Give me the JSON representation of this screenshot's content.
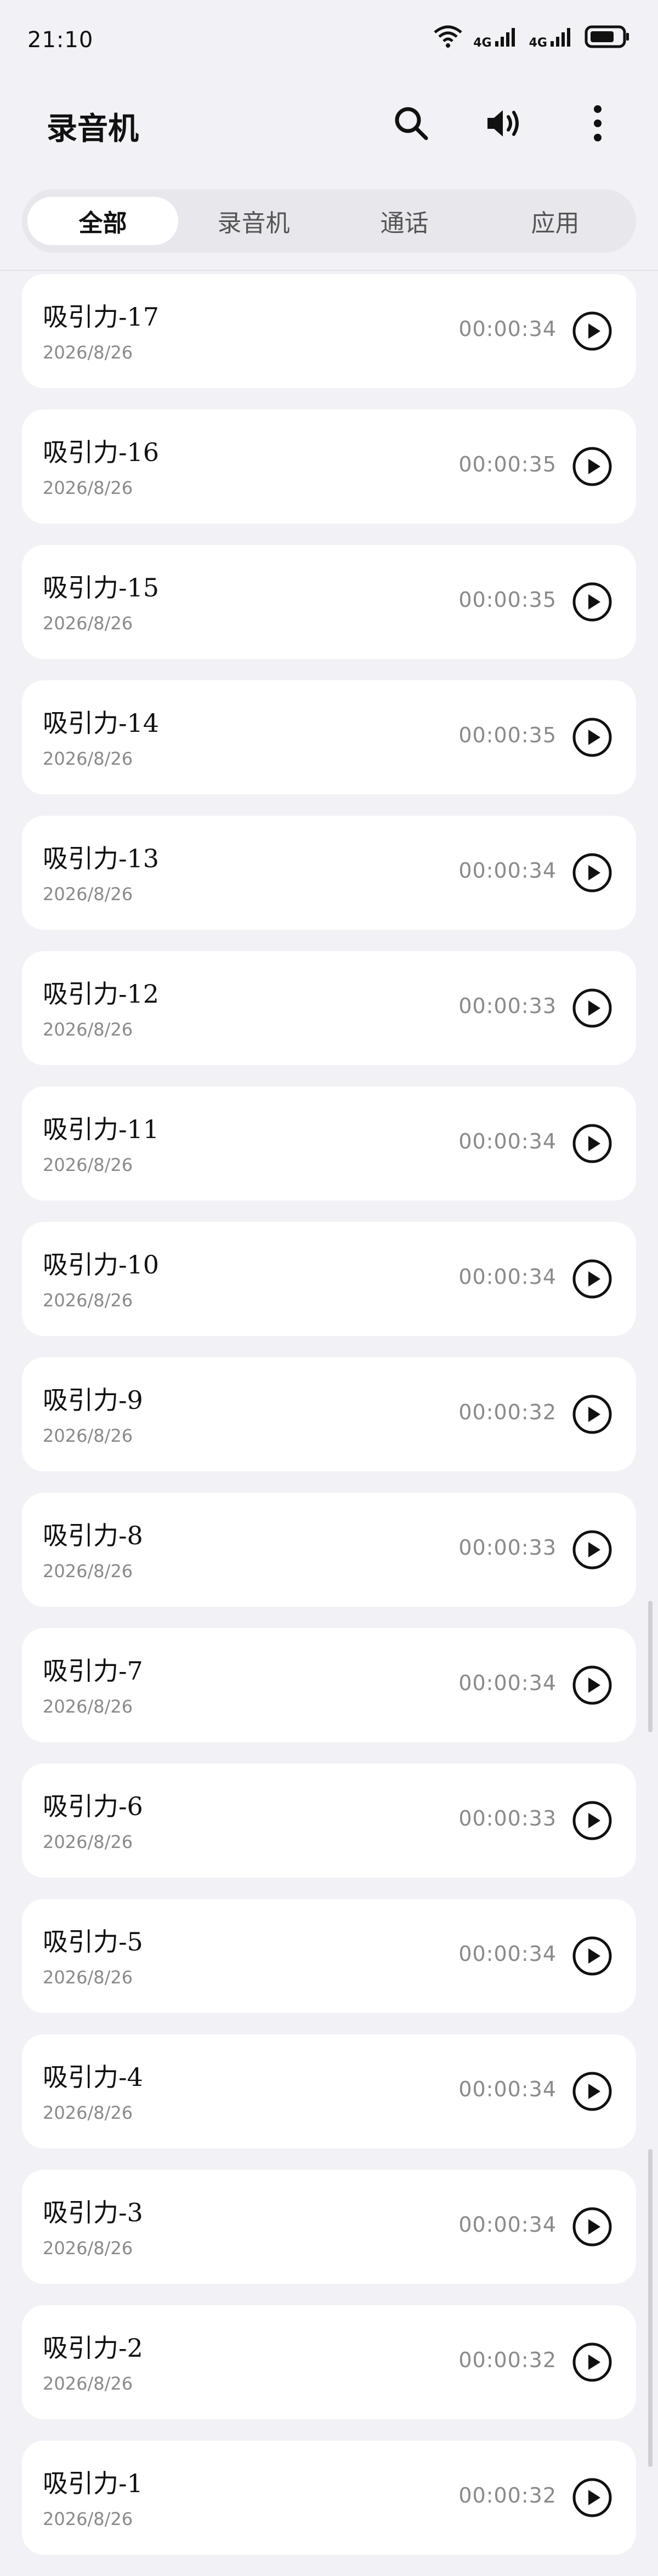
{
  "status_bar": {
    "time": "21:10",
    "net1": "4G",
    "net2": "4G",
    "icons": [
      "wifi-icon",
      "signal-icon",
      "signal-icon",
      "battery-icon"
    ]
  },
  "header": {
    "title": "录音机",
    "actions": [
      "search-icon",
      "speaker-icon",
      "more-vert-icon"
    ]
  },
  "tabs": [
    {
      "label": "全部",
      "active": true
    },
    {
      "label": "录音机",
      "active": false
    },
    {
      "label": "通话",
      "active": false
    },
    {
      "label": "应用",
      "active": false
    }
  ],
  "recordings": [
    {
      "name": "吸引力-17",
      "date": "2026/8/26",
      "duration": "00:00:34"
    },
    {
      "name": "吸引力-16",
      "date": "2026/8/26",
      "duration": "00:00:35"
    },
    {
      "name": "吸引力-15",
      "date": "2026/8/26",
      "duration": "00:00:35"
    },
    {
      "name": "吸引力-14",
      "date": "2026/8/26",
      "duration": "00:00:35"
    },
    {
      "name": "吸引力-13",
      "date": "2026/8/26",
      "duration": "00:00:34"
    },
    {
      "name": "吸引力-12",
      "date": "2026/8/26",
      "duration": "00:00:33"
    },
    {
      "name": "吸引力-11",
      "date": "2026/8/26",
      "duration": "00:00:34"
    },
    {
      "name": "吸引力-10",
      "date": "2026/8/26",
      "duration": "00:00:34"
    },
    {
      "name": "吸引力-9",
      "date": "2026/8/26",
      "duration": "00:00:32"
    },
    {
      "name": "吸引力-8",
      "date": "2026/8/26",
      "duration": "00:00:33"
    },
    {
      "name": "吸引力-7",
      "date": "2026/8/26",
      "duration": "00:00:34"
    },
    {
      "name": "吸引力-6",
      "date": "2026/8/26",
      "duration": "00:00:33"
    },
    {
      "name": "吸引力-5",
      "date": "2026/8/26",
      "duration": "00:00:34"
    },
    {
      "name": "吸引力-4",
      "date": "2026/8/26",
      "duration": "00:00:34"
    },
    {
      "name": "吸引力-3",
      "date": "2026/8/26",
      "duration": "00:00:34"
    },
    {
      "name": "吸引力-2",
      "date": "2026/8/26",
      "duration": "00:00:32"
    },
    {
      "name": "吸引力-1",
      "date": "2026/8/26",
      "duration": "00:00:32"
    }
  ],
  "colors": {
    "background": "#f2f2f6",
    "card": "#ffffff",
    "muted_text": "#8a8a8a",
    "tab_track": "#e7e7ec"
  }
}
